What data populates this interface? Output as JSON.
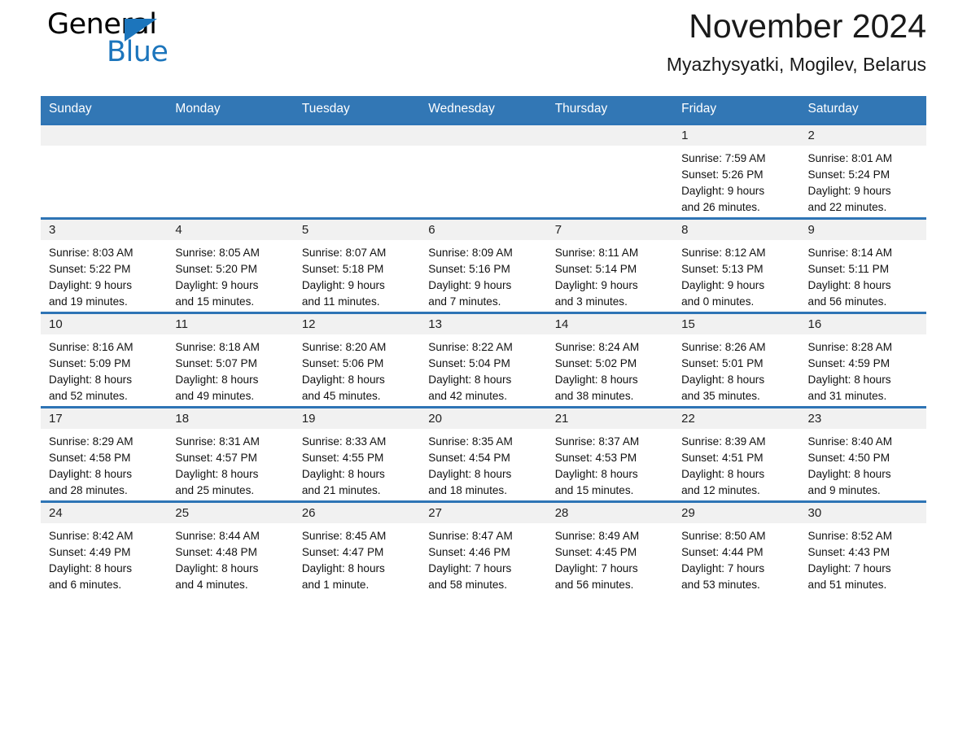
{
  "brand": {
    "name_part1": "General",
    "name_part2": "Blue",
    "accent_color": "#1c75bc"
  },
  "header": {
    "title": "November 2024",
    "location": "Myazhysyatki, Mogilev, Belarus"
  },
  "calendar": {
    "header_bg": "#3277b5",
    "row_divider_color": "#2e74b5",
    "date_band_bg": "#f1f1f1",
    "weekdays": [
      "Sunday",
      "Monday",
      "Tuesday",
      "Wednesday",
      "Thursday",
      "Friday",
      "Saturday"
    ],
    "weeks": [
      [
        {
          "date": "",
          "empty": true
        },
        {
          "date": "",
          "empty": true
        },
        {
          "date": "",
          "empty": true
        },
        {
          "date": "",
          "empty": true
        },
        {
          "date": "",
          "empty": true
        },
        {
          "date": "1",
          "sunrise": "Sunrise: 7:59 AM",
          "sunset": "Sunset: 5:26 PM",
          "daylight1": "Daylight: 9 hours",
          "daylight2": "and 26 minutes."
        },
        {
          "date": "2",
          "sunrise": "Sunrise: 8:01 AM",
          "sunset": "Sunset: 5:24 PM",
          "daylight1": "Daylight: 9 hours",
          "daylight2": "and 22 minutes."
        }
      ],
      [
        {
          "date": "3",
          "sunrise": "Sunrise: 8:03 AM",
          "sunset": "Sunset: 5:22 PM",
          "daylight1": "Daylight: 9 hours",
          "daylight2": "and 19 minutes."
        },
        {
          "date": "4",
          "sunrise": "Sunrise: 8:05 AM",
          "sunset": "Sunset: 5:20 PM",
          "daylight1": "Daylight: 9 hours",
          "daylight2": "and 15 minutes."
        },
        {
          "date": "5",
          "sunrise": "Sunrise: 8:07 AM",
          "sunset": "Sunset: 5:18 PM",
          "daylight1": "Daylight: 9 hours",
          "daylight2": "and 11 minutes."
        },
        {
          "date": "6",
          "sunrise": "Sunrise: 8:09 AM",
          "sunset": "Sunset: 5:16 PM",
          "daylight1": "Daylight: 9 hours",
          "daylight2": "and 7 minutes."
        },
        {
          "date": "7",
          "sunrise": "Sunrise: 8:11 AM",
          "sunset": "Sunset: 5:14 PM",
          "daylight1": "Daylight: 9 hours",
          "daylight2": "and 3 minutes."
        },
        {
          "date": "8",
          "sunrise": "Sunrise: 8:12 AM",
          "sunset": "Sunset: 5:13 PM",
          "daylight1": "Daylight: 9 hours",
          "daylight2": "and 0 minutes."
        },
        {
          "date": "9",
          "sunrise": "Sunrise: 8:14 AM",
          "sunset": "Sunset: 5:11 PM",
          "daylight1": "Daylight: 8 hours",
          "daylight2": "and 56 minutes."
        }
      ],
      [
        {
          "date": "10",
          "sunrise": "Sunrise: 8:16 AM",
          "sunset": "Sunset: 5:09 PM",
          "daylight1": "Daylight: 8 hours",
          "daylight2": "and 52 minutes."
        },
        {
          "date": "11",
          "sunrise": "Sunrise: 8:18 AM",
          "sunset": "Sunset: 5:07 PM",
          "daylight1": "Daylight: 8 hours",
          "daylight2": "and 49 minutes."
        },
        {
          "date": "12",
          "sunrise": "Sunrise: 8:20 AM",
          "sunset": "Sunset: 5:06 PM",
          "daylight1": "Daylight: 8 hours",
          "daylight2": "and 45 minutes."
        },
        {
          "date": "13",
          "sunrise": "Sunrise: 8:22 AM",
          "sunset": "Sunset: 5:04 PM",
          "daylight1": "Daylight: 8 hours",
          "daylight2": "and 42 minutes."
        },
        {
          "date": "14",
          "sunrise": "Sunrise: 8:24 AM",
          "sunset": "Sunset: 5:02 PM",
          "daylight1": "Daylight: 8 hours",
          "daylight2": "and 38 minutes."
        },
        {
          "date": "15",
          "sunrise": "Sunrise: 8:26 AM",
          "sunset": "Sunset: 5:01 PM",
          "daylight1": "Daylight: 8 hours",
          "daylight2": "and 35 minutes."
        },
        {
          "date": "16",
          "sunrise": "Sunrise: 8:28 AM",
          "sunset": "Sunset: 4:59 PM",
          "daylight1": "Daylight: 8 hours",
          "daylight2": "and 31 minutes."
        }
      ],
      [
        {
          "date": "17",
          "sunrise": "Sunrise: 8:29 AM",
          "sunset": "Sunset: 4:58 PM",
          "daylight1": "Daylight: 8 hours",
          "daylight2": "and 28 minutes."
        },
        {
          "date": "18",
          "sunrise": "Sunrise: 8:31 AM",
          "sunset": "Sunset: 4:57 PM",
          "daylight1": "Daylight: 8 hours",
          "daylight2": "and 25 minutes."
        },
        {
          "date": "19",
          "sunrise": "Sunrise: 8:33 AM",
          "sunset": "Sunset: 4:55 PM",
          "daylight1": "Daylight: 8 hours",
          "daylight2": "and 21 minutes."
        },
        {
          "date": "20",
          "sunrise": "Sunrise: 8:35 AM",
          "sunset": "Sunset: 4:54 PM",
          "daylight1": "Daylight: 8 hours",
          "daylight2": "and 18 minutes."
        },
        {
          "date": "21",
          "sunrise": "Sunrise: 8:37 AM",
          "sunset": "Sunset: 4:53 PM",
          "daylight1": "Daylight: 8 hours",
          "daylight2": "and 15 minutes."
        },
        {
          "date": "22",
          "sunrise": "Sunrise: 8:39 AM",
          "sunset": "Sunset: 4:51 PM",
          "daylight1": "Daylight: 8 hours",
          "daylight2": "and 12 minutes."
        },
        {
          "date": "23",
          "sunrise": "Sunrise: 8:40 AM",
          "sunset": "Sunset: 4:50 PM",
          "daylight1": "Daylight: 8 hours",
          "daylight2": "and 9 minutes."
        }
      ],
      [
        {
          "date": "24",
          "sunrise": "Sunrise: 8:42 AM",
          "sunset": "Sunset: 4:49 PM",
          "daylight1": "Daylight: 8 hours",
          "daylight2": "and 6 minutes."
        },
        {
          "date": "25",
          "sunrise": "Sunrise: 8:44 AM",
          "sunset": "Sunset: 4:48 PM",
          "daylight1": "Daylight: 8 hours",
          "daylight2": "and 4 minutes."
        },
        {
          "date": "26",
          "sunrise": "Sunrise: 8:45 AM",
          "sunset": "Sunset: 4:47 PM",
          "daylight1": "Daylight: 8 hours",
          "daylight2": "and 1 minute."
        },
        {
          "date": "27",
          "sunrise": "Sunrise: 8:47 AM",
          "sunset": "Sunset: 4:46 PM",
          "daylight1": "Daylight: 7 hours",
          "daylight2": "and 58 minutes."
        },
        {
          "date": "28",
          "sunrise": "Sunrise: 8:49 AM",
          "sunset": "Sunset: 4:45 PM",
          "daylight1": "Daylight: 7 hours",
          "daylight2": "and 56 minutes."
        },
        {
          "date": "29",
          "sunrise": "Sunrise: 8:50 AM",
          "sunset": "Sunset: 4:44 PM",
          "daylight1": "Daylight: 7 hours",
          "daylight2": "and 53 minutes."
        },
        {
          "date": "30",
          "sunrise": "Sunrise: 8:52 AM",
          "sunset": "Sunset: 4:43 PM",
          "daylight1": "Daylight: 7 hours",
          "daylight2": "and 51 minutes."
        }
      ]
    ]
  }
}
